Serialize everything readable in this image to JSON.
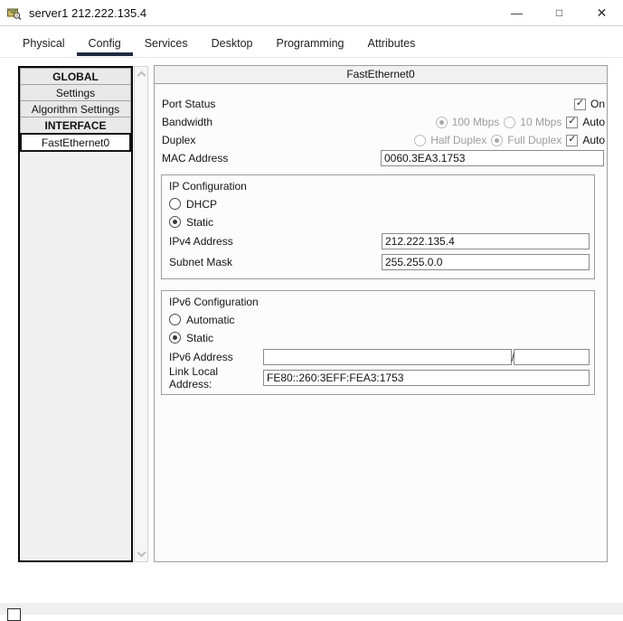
{
  "window": {
    "title": "server1 212.222.135.4",
    "minimize_glyph": "—",
    "maximize_glyph": "□",
    "close_glyph": "✕"
  },
  "tabs": {
    "active": "Config",
    "items": [
      {
        "label": "Physical"
      },
      {
        "label": "Config"
      },
      {
        "label": "Services"
      },
      {
        "label": "Desktop"
      },
      {
        "label": "Programming"
      },
      {
        "label": "Attributes"
      }
    ]
  },
  "sidebar": {
    "selected": "FastEthernet0",
    "items": [
      {
        "label": "GLOBAL",
        "type": "section-header"
      },
      {
        "label": "Settings",
        "type": "button"
      },
      {
        "label": "Algorithm Settings",
        "type": "button"
      },
      {
        "label": "INTERFACE",
        "type": "section-header"
      },
      {
        "label": "FastEthernet0",
        "type": "button-selected"
      }
    ]
  },
  "panel": {
    "header": "FastEthernet0",
    "port_status": {
      "label": "Port Status",
      "checkbox_label": "On",
      "checked": true
    },
    "bandwidth": {
      "label": "Bandwidth",
      "option1": "100 Mbps",
      "option2": "10 Mbps",
      "selected": "100 Mbps",
      "auto_label": "Auto",
      "auto_checked": true
    },
    "duplex": {
      "label": "Duplex",
      "option1": "Half Duplex",
      "option2": "Full Duplex",
      "selected": "Full Duplex",
      "auto_label": "Auto",
      "auto_checked": true
    },
    "mac_address": {
      "label": "MAC Address",
      "value": "0060.3EA3.1753"
    },
    "ip_configuration": {
      "title": "IP Configuration",
      "option1": "DHCP",
      "option2": "Static",
      "selected": "Static",
      "ipv4_address": {
        "label": "IPv4 Address",
        "value": "212.222.135.4"
      },
      "subnet_mask": {
        "label": "Subnet Mask",
        "value": "255.255.0.0"
      }
    },
    "ipv6_configuration": {
      "title": "IPv6 Configuration",
      "option1": "Automatic",
      "option2": "Static",
      "selected": "Static",
      "ipv6_address": {
        "label": "IPv6 Address",
        "value": "",
        "separator": "/",
        "prefix_value": ""
      },
      "link_local_address": {
        "label": "Link Local Address:",
        "value": "FE80::260:3EFF:FEA3:1753"
      }
    }
  },
  "colors": {
    "accent_underline": "#1c2b4a",
    "selected_border": "#161616",
    "panel_border": "#9e9e9e"
  }
}
